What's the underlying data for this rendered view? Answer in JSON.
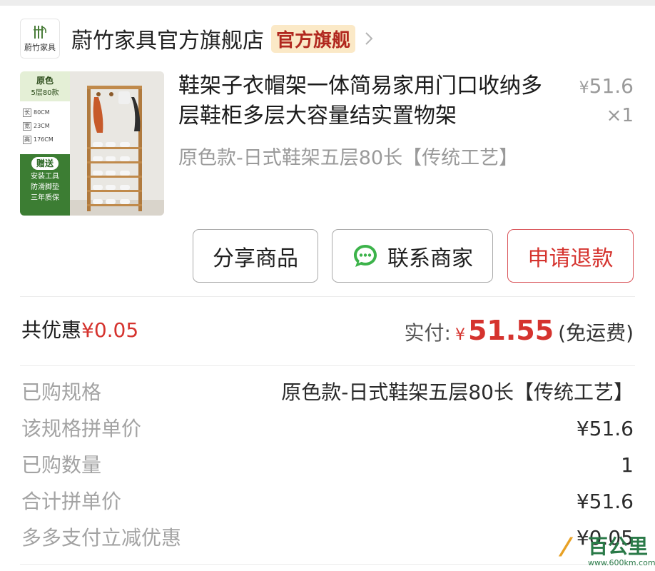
{
  "store": {
    "logo_text": "蔚竹家具",
    "name": "蔚竹家具官方旗舰店",
    "badge": "官方旗舰"
  },
  "product": {
    "title": "鞋架子衣帽架一体简易家用门口收纳多层鞋柜多层大容量结实置物架",
    "spec": "原色款-日式鞋架五层80长【传统工艺】",
    "price_symbol": "¥",
    "price": "51.6",
    "quantity": "×1",
    "thumbnail": {
      "color_name": "原色",
      "color_spec": "5层80款",
      "dims": [
        {
          "key": "长",
          "value": "80CM"
        },
        {
          "key": "宽",
          "value": "23CM"
        },
        {
          "key": "高",
          "value": "176CM"
        }
      ],
      "gift_title": "赠送",
      "gift_lines": [
        "安装工具",
        "防滑脚垫",
        "三年质保"
      ]
    }
  },
  "actions": {
    "share": "分享商品",
    "contact": "联系商家",
    "refund": "申请退款"
  },
  "summary": {
    "discount_label": "共优惠",
    "discount_value": "¥0.05",
    "paid_label": "实付:",
    "paid_symbol": "¥",
    "paid_amount": "51.55",
    "paid_note": "(免运费)"
  },
  "details": [
    {
      "label": "已购规格",
      "value": "原色款-日式鞋架五层80长【传统工艺】"
    },
    {
      "label": "该规格拼单价",
      "value": "¥51.6"
    },
    {
      "label": "已购数量",
      "value": "1"
    },
    {
      "label": "合计拼单价",
      "value": "¥51.6"
    },
    {
      "label": "多多支付立减优惠",
      "value": "¥0.05"
    }
  ],
  "watermark": {
    "text": "百公里",
    "url": "www.600km.com"
  },
  "colors": {
    "accent_red": "#d5332e",
    "badge_bg": "#fbe9c7",
    "muted_text": "#a3a3a3",
    "chat_green": "#3cb34a"
  }
}
